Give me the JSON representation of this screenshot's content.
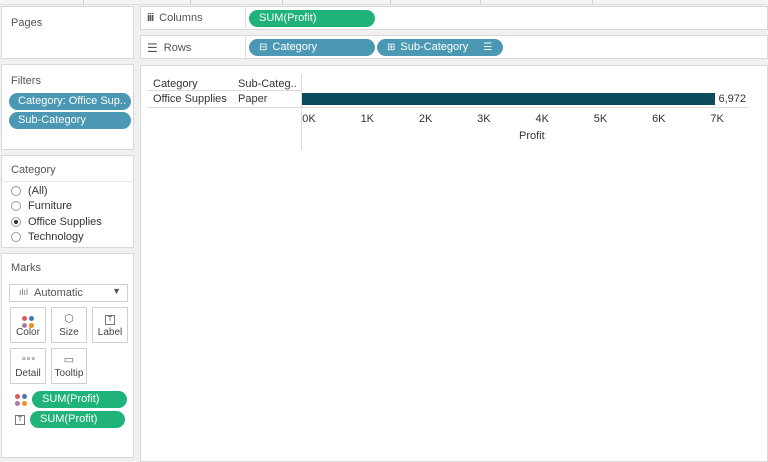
{
  "pages": {
    "title": "Pages"
  },
  "columns_shelf": {
    "label": "Columns",
    "icon": "columns-icon",
    "pills": [
      {
        "label": "SUM(Profit)",
        "color": "#1fb37a"
      }
    ]
  },
  "rows_shelf": {
    "label": "Rows",
    "icon": "rows-icon",
    "pills": [
      {
        "label": "Category",
        "color": "#4a98b4"
      },
      {
        "label": "Sub-Category",
        "color": "#4a98b4"
      }
    ]
  },
  "filters": {
    "title": "Filters",
    "items": [
      "Category: Office Sup..",
      "Sub-Category"
    ]
  },
  "category_filter": {
    "title": "Category",
    "options": [
      {
        "label": "(All)",
        "selected": false
      },
      {
        "label": "Furniture",
        "selected": false
      },
      {
        "label": "Office Supplies",
        "selected": true
      },
      {
        "label": "Technology",
        "selected": false
      }
    ]
  },
  "marks": {
    "title": "Marks",
    "mark_type": "Automatic",
    "cards": [
      "Color",
      "Size",
      "Label",
      "Detail",
      "Tooltip"
    ],
    "fields": [
      {
        "encoding": "color",
        "label": "SUM(Profit)"
      },
      {
        "encoding": "label",
        "label": "SUM(Profit)"
      }
    ]
  },
  "view": {
    "row_headers": [
      "Category",
      "Sub-Categ.."
    ],
    "row_values": [
      "Office Supplies",
      "Paper"
    ],
    "bar_label": "6,972",
    "axis_title": "Profit",
    "axis_ticks": [
      "0K",
      "1K",
      "2K",
      "3K",
      "4K",
      "5K",
      "6K",
      "7K"
    ],
    "bar_color": "#0b4b5d"
  },
  "chart_data": {
    "type": "bar",
    "orientation": "horizontal",
    "categories": [
      "Office Supplies | Paper"
    ],
    "values": [
      6972
    ],
    "xlabel": "Profit",
    "xlim": [
      0,
      7000
    ],
    "grid": false
  }
}
